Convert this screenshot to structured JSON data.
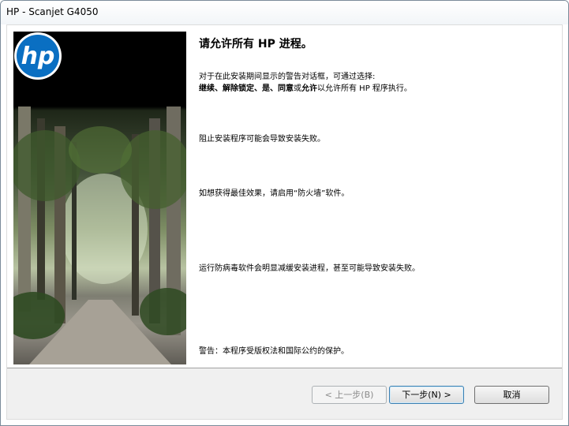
{
  "window": {
    "title": "HP - Scanjet G4050"
  },
  "content": {
    "heading": "请允许所有 HP 进程。",
    "para1_line1": "对于在此安装期间显示的警告对话框，可通过选择:",
    "para1_line2": {
      "opt1": "继续",
      "sep1": "、",
      "opt2": "解除锁定",
      "sep2": "、",
      "opt3": "是",
      "sep3": "、",
      "opt4": "同意",
      "or": "或",
      "opt5": "允许",
      "tail": "以允许所有 HP 程序执行。"
    },
    "para2": "阻止安装程序可能会导致安装失败。",
    "para3": "如想获得最佳效果，请启用“防火墙”软件。",
    "para4": "运行防病毒软件会明显减缓安装进程，甚至可能导致安装失败。",
    "para5": "警告：本程序受版权法和国际公约的保护。"
  },
  "hero": {
    "logo_text": "hp",
    "logo_color": "#0a6fc2"
  },
  "buttons": {
    "back": "< 上一步(B)",
    "next": "下一步(N) >",
    "cancel": "取消"
  }
}
